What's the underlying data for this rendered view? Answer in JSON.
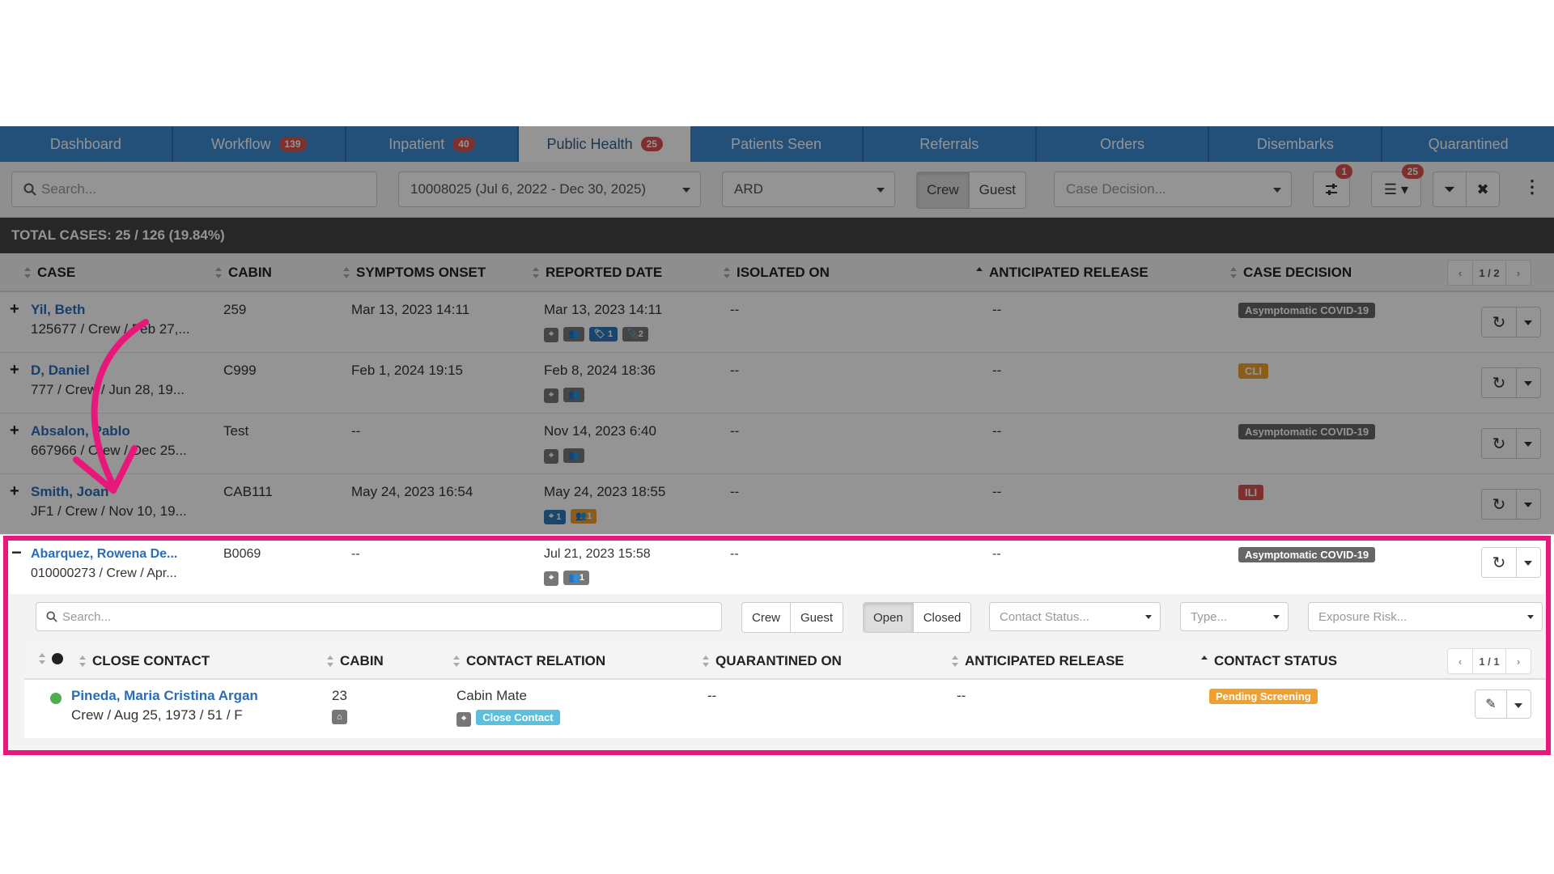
{
  "tabs": [
    {
      "label": "Dashboard",
      "badge": ""
    },
    {
      "label": "Workflow",
      "badge": "139"
    },
    {
      "label": "Inpatient",
      "badge": "40"
    },
    {
      "label": "Public Health",
      "badge": "25"
    },
    {
      "label": "Patients Seen",
      "badge": ""
    },
    {
      "label": "Referrals",
      "badge": ""
    },
    {
      "label": "Orders",
      "badge": ""
    },
    {
      "label": "Disembarks",
      "badge": ""
    },
    {
      "label": "Quarantined",
      "badge": ""
    }
  ],
  "filters": {
    "search_placeholder": "Search...",
    "voyage": "10008025 (Jul 6, 2022 - Dec 30, 2025)",
    "category": "ARD",
    "crew_label": "Crew",
    "guest_label": "Guest",
    "case_decision_placeholder": "Case Decision...",
    "settings_badge": "1",
    "list_badge": "25"
  },
  "total_label": "TOTAL CASES: 25 / 126 (19.84%)",
  "columns": {
    "case": "CASE",
    "cabin": "CABIN",
    "symptoms_onset": "SYMPTOMS ONSET",
    "reported_date": "REPORTED DATE",
    "isolated_on": "ISOLATED ON",
    "anticipated_release": "ANTICIPATED RELEASE",
    "case_decision": "CASE DECISION",
    "pager": "1 / 2"
  },
  "rows": [
    {
      "toggle": "+",
      "name": "Yil, Beth",
      "sub": "125677 / Crew / Feb 27,...",
      "cabin": "259",
      "onset": "Mar 13, 2023 14:11",
      "reported": "Mar 13, 2023 14:11",
      "isolated": "--",
      "release": "--",
      "decision": "Asymptomatic COVID-19",
      "tag1": "1",
      "tag2": "2"
    },
    {
      "toggle": "+",
      "name": "D, Daniel",
      "sub": "777 / Crew / Jun 28, 19...",
      "cabin": "C999",
      "onset": "Feb 1, 2024 19:15",
      "reported": "Feb 8, 2024 18:36",
      "isolated": "--",
      "release": "--",
      "decision": "CLI"
    },
    {
      "toggle": "+",
      "name": "Absalon, Pablo",
      "sub": "667966 / Crew / Dec 25...",
      "cabin": "Test",
      "onset": "--",
      "reported": "Nov 14, 2023 6:40",
      "isolated": "--",
      "release": "--",
      "decision": "Asymptomatic COVID-19"
    },
    {
      "toggle": "+",
      "name": "Smith, Joan",
      "sub": "JF1 / Crew / Nov 10, 19...",
      "cabin": "CAB111",
      "onset": "May 24, 2023 16:54",
      "reported": "May 24, 2023 18:55",
      "isolated": "--",
      "release": "--",
      "decision": "ILI",
      "chip1": "1",
      "chip2": "1"
    }
  ],
  "expanded": {
    "toggle": "−",
    "name": "Abarquez, Rowena De...",
    "sub": "010000273 / Crew / Apr...",
    "cabin": "B0069",
    "onset": "--",
    "reported": "Jul 21, 2023 15:58",
    "isolated": "--",
    "release": "--",
    "decision": "Asymptomatic COVID-19",
    "chip": "1",
    "sub_filters": {
      "search_placeholder": "Search...",
      "crew_label": "Crew",
      "guest_label": "Guest",
      "open_label": "Open",
      "closed_label": "Closed",
      "contact_status_placeholder": "Contact Status...",
      "type_placeholder": "Type...",
      "exposure_placeholder": "Exposure Risk..."
    },
    "sub_columns": {
      "close_contact": "CLOSE CONTACT",
      "cabin": "CABIN",
      "contact_relation": "CONTACT RELATION",
      "quarantined_on": "QUARANTINED ON",
      "anticipated_release": "ANTICIPATED RELEASE",
      "contact_status": "CONTACT STATUS",
      "pager": "1 / 1"
    },
    "contact": {
      "name": "Pineda, Maria Cristina Argan",
      "sub": "Crew / Aug 25, 1973 / 51 / F",
      "cabin": "23",
      "relation": "Cabin Mate",
      "relation_tag": "Close Contact",
      "quarantined": "--",
      "release": "--",
      "status": "Pending Screening"
    }
  },
  "colors": {
    "tab_bar": "#3b8ad0",
    "highlight": "#e8177a",
    "badge": "#d9534f",
    "link": "#2a6db5",
    "annotation_arrow": "#e8177a"
  }
}
